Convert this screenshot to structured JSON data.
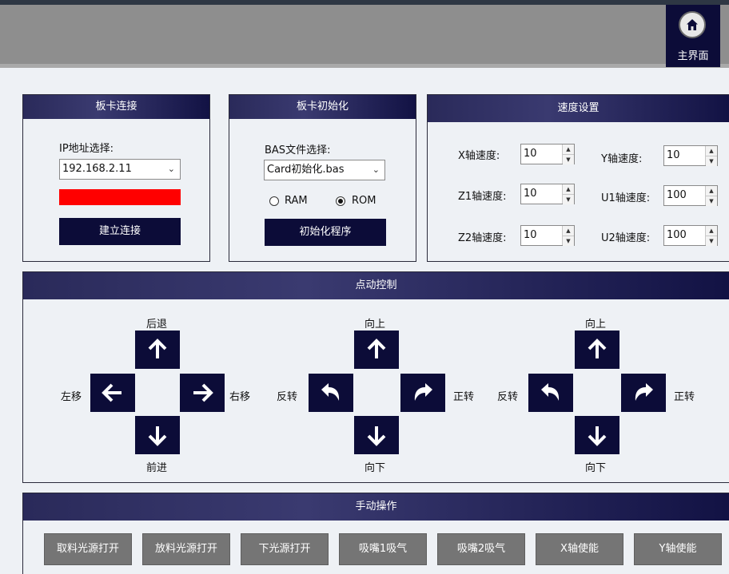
{
  "home": {
    "label": "主界面",
    "icon": "home-icon"
  },
  "card_connect": {
    "title": "板卡连接",
    "ip_label": "IP地址选择:",
    "ip_value": "192.168.2.11",
    "status_color": "#ff0000",
    "connect_label": "建立连接"
  },
  "card_init": {
    "title": "板卡初始化",
    "bas_label": "BAS文件选择:",
    "bas_value": "Card初始化.bas",
    "ram_label": "RAM",
    "rom_label": "ROM",
    "selected": "ROM",
    "init_label": "初始化程序"
  },
  "speed": {
    "title": "速度设置",
    "x_label": "X轴速度:",
    "x_value": "10",
    "y_label": "Y轴速度:",
    "y_value": "10",
    "z1_label": "Z1轴速度:",
    "z1_value": "10",
    "u1_label": "U1轴速度:",
    "u1_value": "100",
    "z2_label": "Z2轴速度:",
    "z2_value": "10",
    "u2_label": "U2轴速度:",
    "u2_value": "100"
  },
  "jog": {
    "title": "点动控制",
    "pad1": {
      "up": "后退",
      "down": "前进",
      "left": "左移",
      "right": "右移"
    },
    "pad2": {
      "up": "向上",
      "down": "向下",
      "left": "反转",
      "right": "正转"
    },
    "pad3": {
      "up": "向上",
      "down": "向下",
      "left": "反转",
      "right": "正转"
    }
  },
  "manual": {
    "title": "手动操作",
    "buttons": [
      "取料光源打开",
      "放料光源打开",
      "下光源打开",
      "吸嘴1吸气",
      "吸嘴2吸气",
      "X轴使能",
      "Y轴使能"
    ]
  },
  "colors": {
    "navy": "#0c0c38",
    "status_red": "#ff0000"
  }
}
